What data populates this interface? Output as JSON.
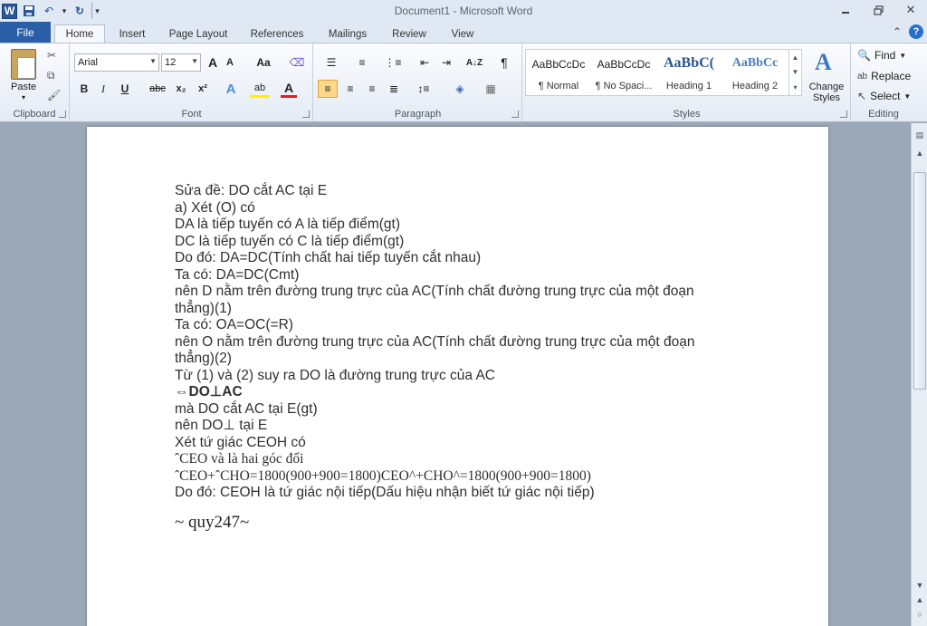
{
  "window": {
    "title": "Document1 - Microsoft Word",
    "app_icon": "W",
    "minimize": "—",
    "restore": "❐",
    "close": "✕"
  },
  "qat": {
    "save": "💾",
    "undo": "↶",
    "undo_drop": "▾",
    "redo": "↻",
    "customize": "▾"
  },
  "tabs": {
    "file": "File",
    "items": [
      "Home",
      "Insert",
      "Page Layout",
      "References",
      "Mailings",
      "Review",
      "View"
    ],
    "minimize_ribbon": "⌃",
    "help": "?"
  },
  "ribbon": {
    "clipboard": {
      "label": "Clipboard",
      "paste": "Paste",
      "paste_arrow": "▾"
    },
    "font": {
      "label": "Font",
      "font_name": "Arial",
      "font_size": "12",
      "grow": "A",
      "shrink": "A",
      "change_case": "Aa",
      "bold": "B",
      "italic": "I",
      "underline": "U",
      "strike": "abc",
      "subscript": "x₂",
      "superscript": "x²",
      "text_effects": "A",
      "highlight": "ab",
      "font_color": "A"
    },
    "paragraph": {
      "label": "Paragraph",
      "pilcrow": "¶",
      "sort": "A↓Z"
    },
    "styles": {
      "label": "Styles",
      "items": [
        {
          "sample": "AaBbCcDc",
          "name": "¶ Normal"
        },
        {
          "sample": "AaBbCcDc",
          "name": "¶ No Spaci..."
        },
        {
          "sample": "AaBbC(",
          "name": "Heading 1"
        },
        {
          "sample": "AaBbCc",
          "name": "Heading 2"
        }
      ],
      "change_styles": "Change Styles"
    },
    "editing": {
      "label": "Editing",
      "find": "Find",
      "replace": "Replace",
      "select": "Select"
    }
  },
  "document": {
    "lines": [
      "Sửa đề: DO cắt AC tại E",
      "a) Xét (O) có",
      "DA là tiếp tuyến có A là tiếp điểm(gt)",
      "DC là tiếp tuyến có C là tiếp điểm(gt)",
      "Do đó: DA=DC(Tính chất hai tiếp tuyến cắt nhau)",
      "Ta có: DA=DC(Cmt)",
      "nên D nằm trên đường trung trực của AC(Tính chất đường trung trực của một đoạn",
      "thẳng)(1)",
      "Ta có: OA=OC(=R)",
      "nên O nằm trên đường trung trực của AC(Tính chất đường trung trực của một  đoạn",
      "thẳng)(2)",
      "Từ (1) và (2) suy ra DO là đường trung trực của AC",
      "⇔DO⊥AC",
      "mà DO cắt AC tại E(gt)",
      "nên DO⊥ tại E",
      "Xét tứ giác CEOH có",
      "ˆCEO và  là hai góc đối",
      "ˆCEO+ˆCHO=1800(900+900=1800)CEO^+CHO^=1800(900+900=1800)",
      "Do đó: CEOH là tứ giác nội tiếp(Dấu hiệu nhận biết tứ giác nội tiếp)"
    ],
    "signature": "~ quy247~"
  }
}
